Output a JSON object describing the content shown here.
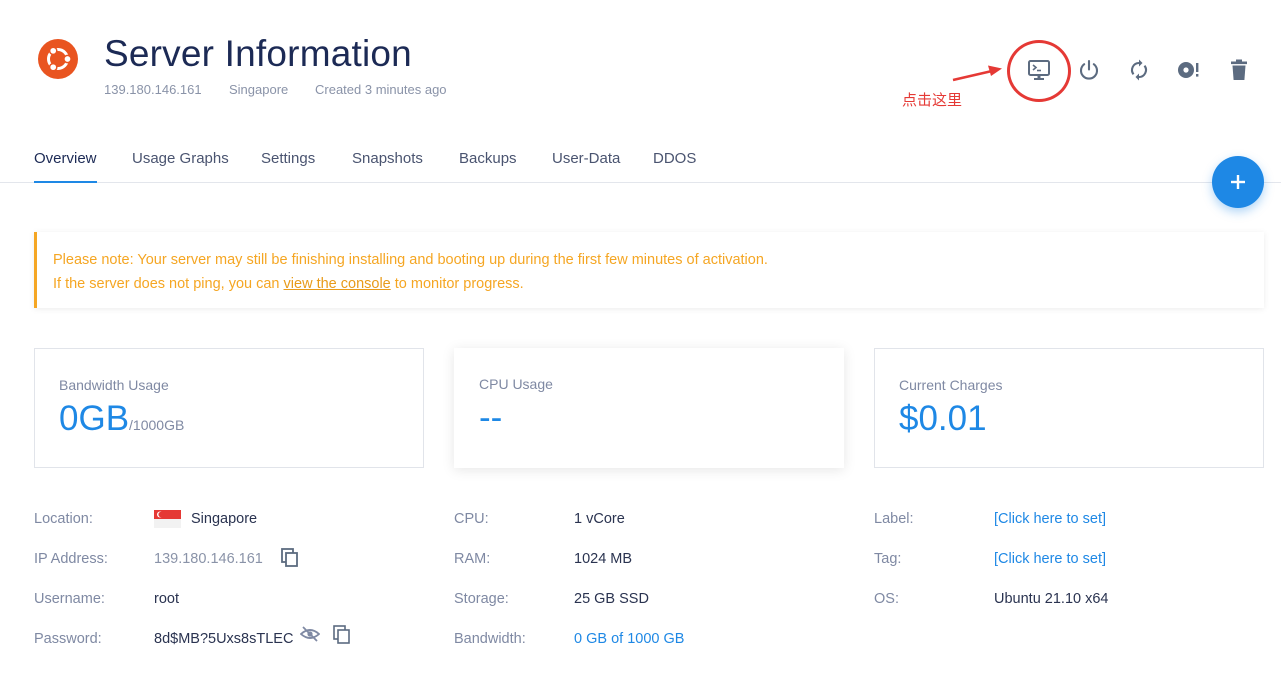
{
  "header": {
    "title": "Server Information",
    "ip": "139.180.146.161",
    "location": "Singapore",
    "created": "Created 3 minutes ago",
    "os_logo": "ubuntu-logo",
    "accent_color": "#e95420"
  },
  "actions": [
    {
      "name": "console",
      "icon": "console-monitor-icon"
    },
    {
      "name": "power",
      "icon": "power-icon"
    },
    {
      "name": "restart",
      "icon": "restart-icon"
    },
    {
      "name": "reinstall",
      "icon": "disc-reinstall-icon"
    },
    {
      "name": "delete",
      "icon": "trash-icon"
    }
  ],
  "annotation": {
    "hint_text": "点击这里",
    "color": "#e53935"
  },
  "tabs": [
    {
      "label": "Overview",
      "active": true
    },
    {
      "label": "Usage Graphs"
    },
    {
      "label": "Settings"
    },
    {
      "label": "Snapshots"
    },
    {
      "label": "Backups"
    },
    {
      "label": "User-Data"
    },
    {
      "label": "DDOS"
    }
  ],
  "fab": {
    "icon": "plus-icon"
  },
  "notice": {
    "line1": "Please note: Your server may still be finishing installing and booting up during the first few minutes of activation.",
    "line2_prefix": "If the server does not ping, you can ",
    "line2_link": "view the console",
    "line2_suffix": " to monitor progress.",
    "color": "#f5a623"
  },
  "cards": {
    "bandwidth": {
      "label": "Bandwidth Usage",
      "value": "0GB",
      "unit": "/1000GB"
    },
    "cpu": {
      "label": "CPU Usage",
      "value": "--"
    },
    "charges": {
      "label": "Current Charges",
      "value": "$0.01"
    }
  },
  "info": {
    "location_label": "Location:",
    "location_value": "Singapore",
    "ip_label": "IP Address:",
    "ip_value": "139.180.146.161",
    "username_label": "Username:",
    "username_value": "root",
    "password_label": "Password:",
    "password_value": "8d$MB?5Uxs8sTLEC",
    "cpu_label": "CPU:",
    "cpu_value": "1 vCore",
    "ram_label": "RAM:",
    "ram_value": "1024 MB",
    "storage_label": "Storage:",
    "storage_value": "25 GB SSD",
    "bandwidth_label": "Bandwidth:",
    "bandwidth_value": "0 GB of 1000 GB",
    "label_label": "Label:",
    "label_value": "[Click here to set]",
    "tag_label": "Tag:",
    "tag_value": "[Click here to set]",
    "os_label": "OS:",
    "os_value": "Ubuntu 21.10 x64"
  },
  "colors": {
    "primary": "#1e88e5",
    "title": "#1c2a55",
    "muted": "#7f89a3"
  }
}
